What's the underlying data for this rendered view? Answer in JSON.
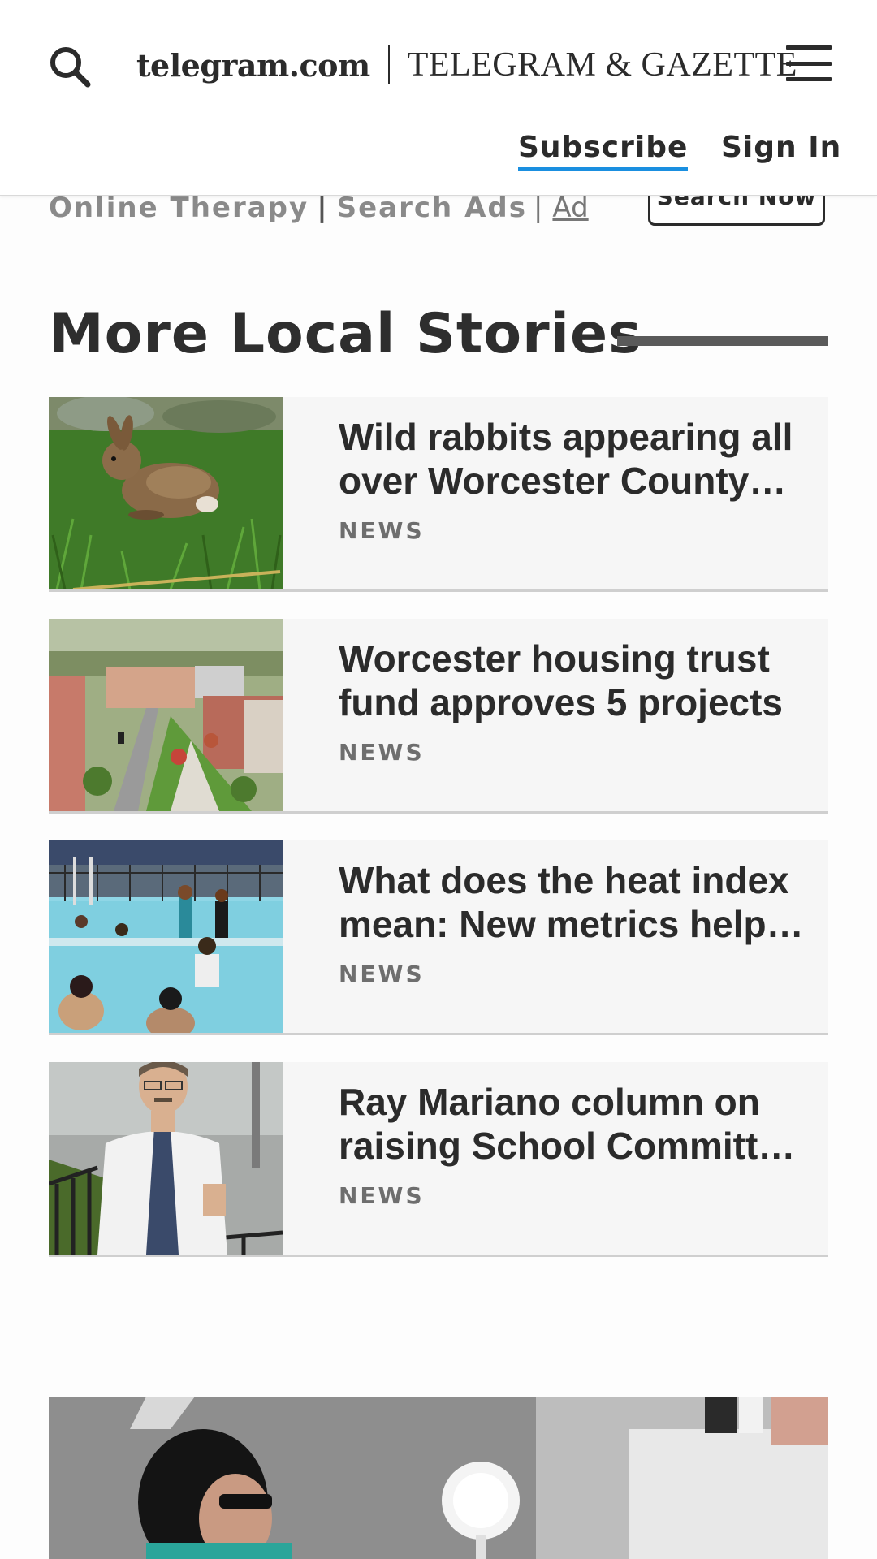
{
  "header": {
    "site_name": "telegram.com",
    "paper_name": "TELEGRAM & GAZETTE",
    "subscribe_label": "Subscribe",
    "signin_label": "Sign In",
    "search_icon": "search-icon",
    "menu_icon": "hamburger-menu-icon",
    "accent_color": "#1a8fe0"
  },
  "ad": {
    "text_part1": "Online Therapy",
    "separator": "|",
    "text_part2": "Search Ads",
    "ad_label": "Ad",
    "button_label": "Search Now"
  },
  "section": {
    "title": "More Local Stories"
  },
  "stories": [
    {
      "headline": "Wild rabbits appearing all over Worcester County…",
      "category": "NEWS",
      "image": "rabbit-in-grass"
    },
    {
      "headline": "Worcester housing trust fund approves 5 projects",
      "category": "NEWS",
      "image": "housing-rendering"
    },
    {
      "headline": "What does the heat index mean: New metrics help…",
      "category": "NEWS",
      "image": "public-pool"
    },
    {
      "headline": "Ray Mariano column on raising School Committ…",
      "category": "NEWS",
      "image": "man-in-white-shirt"
    }
  ]
}
